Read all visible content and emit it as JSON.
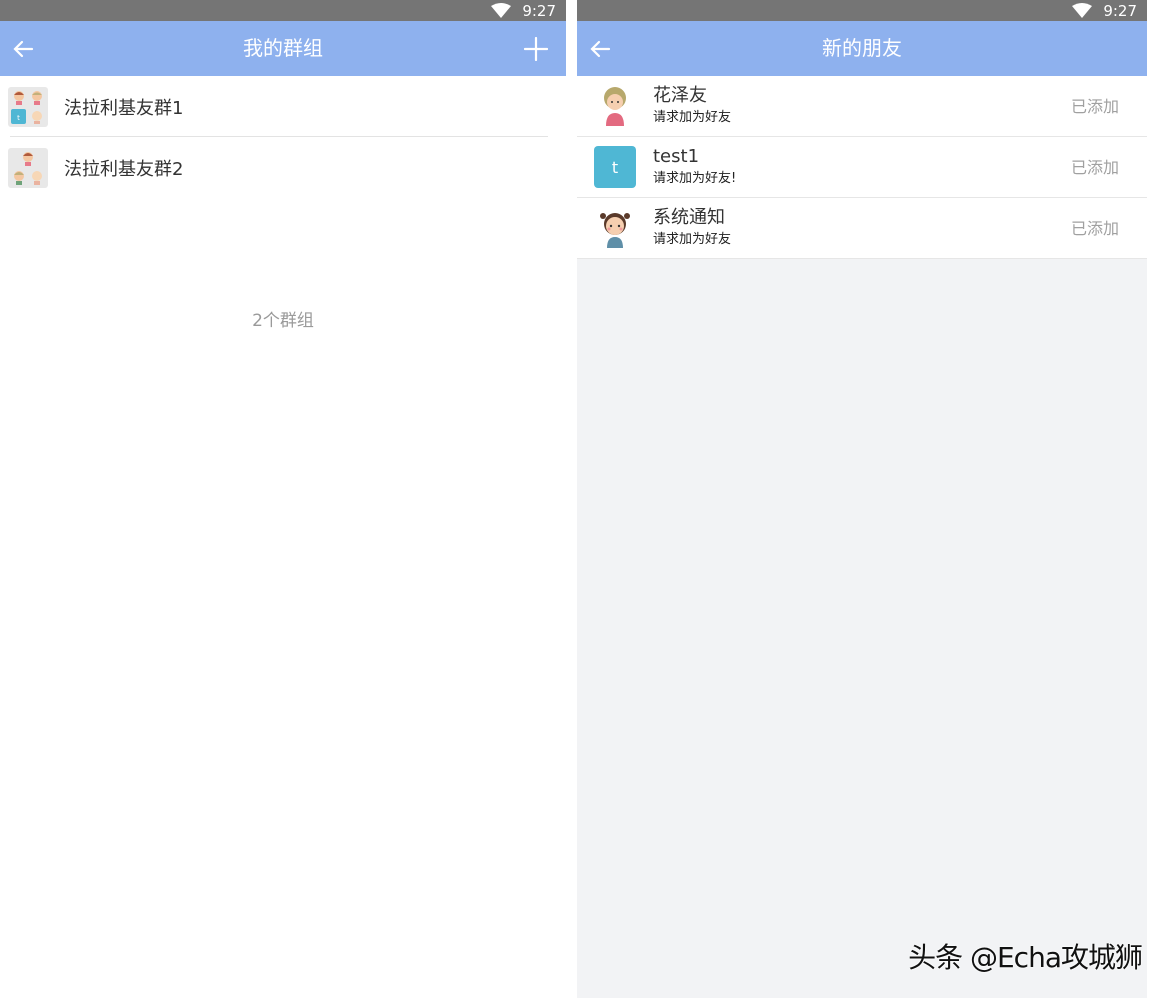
{
  "left": {
    "status_time": "9:27",
    "title": "我的群组",
    "groups": [
      {
        "name": "法拉利基友群1"
      },
      {
        "name": "法拉利基友群2"
      }
    ],
    "group_count": "2个群组"
  },
  "right": {
    "status_time": "9:27",
    "title": "新的朋友",
    "friends": [
      {
        "name": "花泽友",
        "message": "请求加为好友",
        "status": "已添加"
      },
      {
        "name": "test1",
        "message": "请求加为好友!",
        "status": "已添加",
        "avatar_letter": "t"
      },
      {
        "name": "系统通知",
        "message": "请求加为好友",
        "status": "已添加"
      }
    ]
  },
  "watermark": "头条 @Echa攻城狮",
  "colors": {
    "appbar": "#8eb1ee",
    "statusbar": "#757575",
    "avatar_teal": "#4fb7d4"
  }
}
